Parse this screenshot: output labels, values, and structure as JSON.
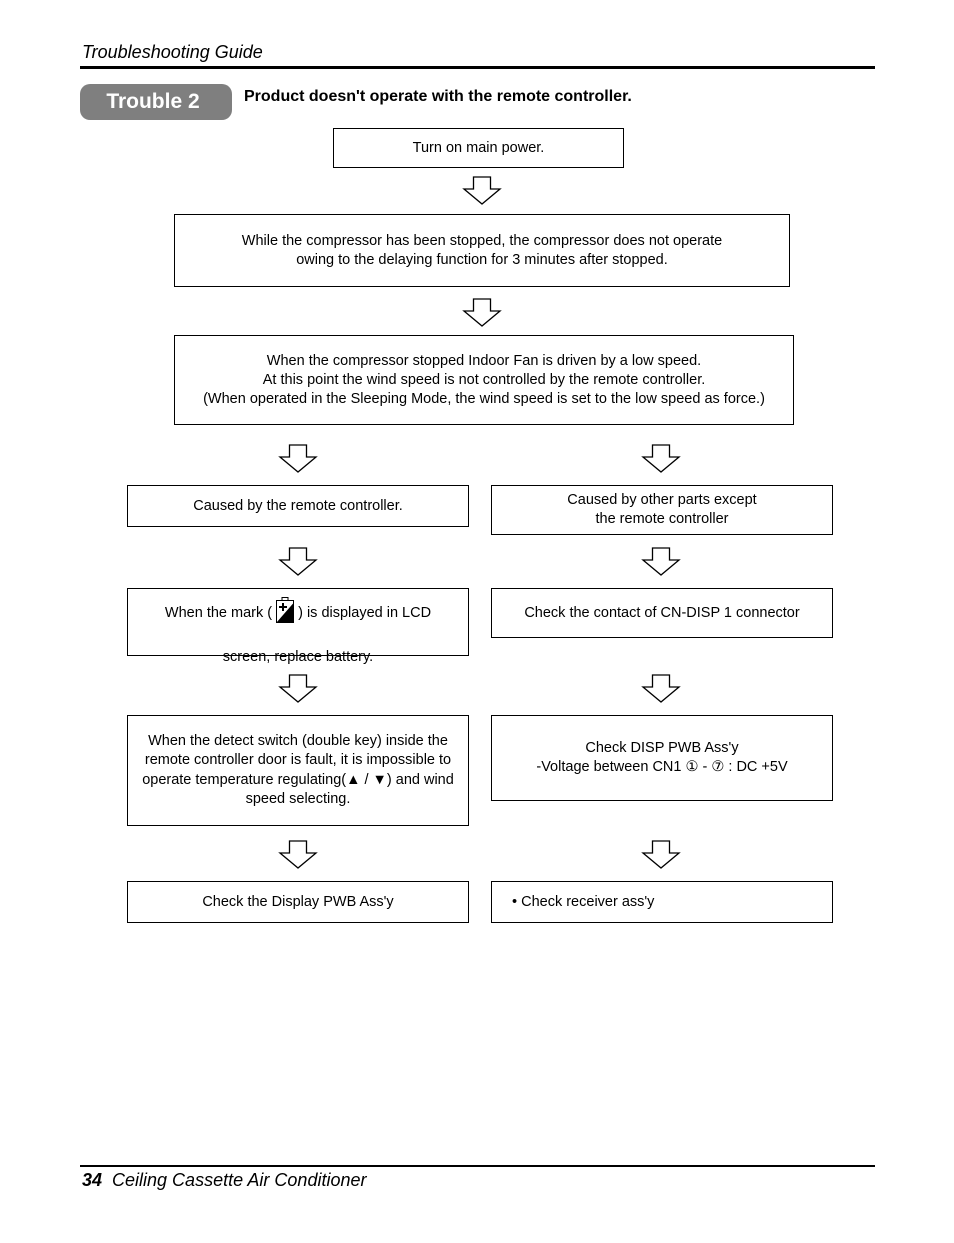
{
  "header": {
    "section_title": "Troubleshooting Guide"
  },
  "trouble": {
    "badge_label": "Trouble 2",
    "title": "Product doesn't operate with the remote controller."
  },
  "flow": {
    "step1": "Turn on main power.",
    "step2": "While the compressor has been stopped, the compressor does not operate\nowing to the delaying function for 3 minutes after stopped.",
    "step3": "When the compressor stopped Indoor Fan is driven by a low speed.\nAt this point the wind speed is not controlled by the remote controller.\n(When operated in the Sleeping Mode, the wind speed is set to the low speed as force.)",
    "left": {
      "cause": "Caused by the remote controller.",
      "battery_prefix": "When the mark (",
      "battery_icon": "battery-low-icon",
      "battery_suffix": ") is displayed in LCD",
      "battery_line2": "screen, replace battery.",
      "detect_switch": "When the detect switch (double key) inside the\nremote controller door is fault, it is impossible to\noperate temperature regulating(▲ / ▼) and wind\nspeed selecting.",
      "final": "Check the Display PWB Ass'y"
    },
    "right": {
      "cause": "Caused by other parts except\nthe remote controller",
      "connector": "Check the contact of CN-DISP 1 connector",
      "disp_pwb": "Check DISP PWB Ass'y\n-Voltage between CN1 ① - ⑦ : DC +5V",
      "final": "• Check receiver ass'y"
    }
  },
  "footer": {
    "page_number": "34",
    "product_name": "Ceiling Cassette Air Conditioner"
  }
}
